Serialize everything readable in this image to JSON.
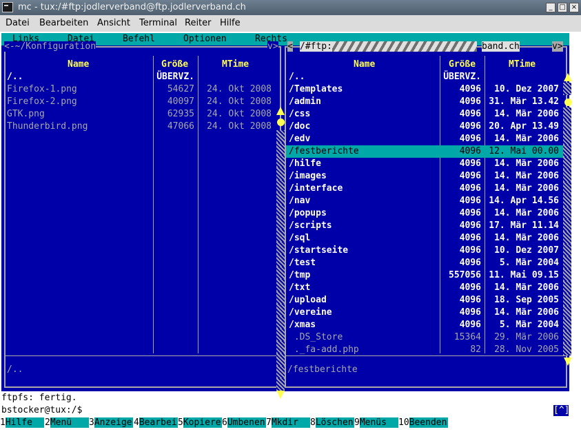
{
  "window": {
    "title": "mc - tux:/#ftp:jodlerverband@ftp.jodlerverband.ch"
  },
  "app_menu": [
    "Datei",
    "Bearbeiten",
    "Ansicht",
    "Terminal",
    "Reiter",
    "Hilfe"
  ],
  "mc_menu": [
    "Links",
    "Datei",
    "Befehl",
    "Optionen",
    "Rechts"
  ],
  "left_panel": {
    "title": "<-~/Konfiguration",
    "title_right": "v>",
    "headers": {
      "name": "Name",
      "size": "Größe",
      "mtime": "MTime"
    },
    "rows": [
      {
        "name": "/..",
        "size": "ÜBERVZ.",
        "mtime": "",
        "style": "bold"
      },
      {
        "name": "Firefox-1.png",
        "size": "54627",
        "mtime": "24. Okt 2008",
        "style": "normal"
      },
      {
        "name": "Firefox-2.png",
        "size": "40097",
        "mtime": "24. Okt 2008",
        "style": "normal"
      },
      {
        "name": "GTK.png",
        "size": "62935",
        "mtime": "24. Okt 2008",
        "style": "normal"
      },
      {
        "name": "Thunderbird.png",
        "size": "47066",
        "mtime": "24. Okt 2008",
        "style": "normal"
      }
    ],
    "current": "/.."
  },
  "right_panel": {
    "title_left": "<",
    "title_path_start": "/#ftp:",
    "title_path_end": "band.ch",
    "title_right": "v>",
    "headers": {
      "name": "Name",
      "size": "Größe",
      "mtime": "MTime"
    },
    "rows": [
      {
        "name": "/..",
        "size": "ÜBERVZ.",
        "mtime": "",
        "style": "bold"
      },
      {
        "name": "/Templates",
        "size": "4096",
        "mtime": "10. Dez 2007",
        "style": "bold"
      },
      {
        "name": "/admin",
        "size": "4096",
        "mtime": "31. Mär 13.42",
        "style": "bold"
      },
      {
        "name": "/css",
        "size": "4096",
        "mtime": "14. Mär 2006",
        "style": "bold"
      },
      {
        "name": "/doc",
        "size": "4096",
        "mtime": "20. Apr 13.49",
        "style": "bold"
      },
      {
        "name": "/edv",
        "size": "4096",
        "mtime": "14. Mär 2006",
        "style": "bold"
      },
      {
        "name": "/festberichte",
        "size": "4096",
        "mtime": "12. Mai 00.00",
        "style": "selected"
      },
      {
        "name": "/hilfe",
        "size": "4096",
        "mtime": "14. Mär 2006",
        "style": "bold"
      },
      {
        "name": "/images",
        "size": "4096",
        "mtime": "14. Mär 2006",
        "style": "bold"
      },
      {
        "name": "/interface",
        "size": "4096",
        "mtime": "14. Mär 2006",
        "style": "bold"
      },
      {
        "name": "/nav",
        "size": "4096",
        "mtime": "14. Apr 14.56",
        "style": "bold"
      },
      {
        "name": "/popups",
        "size": "4096",
        "mtime": "14. Mär 2006",
        "style": "bold"
      },
      {
        "name": "/scripts",
        "size": "4096",
        "mtime": "17. Mär 11.14",
        "style": "bold"
      },
      {
        "name": "/sql",
        "size": "4096",
        "mtime": "14. Mär 2006",
        "style": "bold"
      },
      {
        "name": "/startseite",
        "size": "4096",
        "mtime": "10. Dez 2007",
        "style": "bold"
      },
      {
        "name": "/test",
        "size": "4096",
        "mtime": "5. Mär 2004",
        "style": "bold"
      },
      {
        "name": "/tmp",
        "size": "557056",
        "mtime": "11. Mai 09.15",
        "style": "bold"
      },
      {
        "name": "/txt",
        "size": "4096",
        "mtime": "14. Mär 2006",
        "style": "bold"
      },
      {
        "name": "/upload",
        "size": "4096",
        "mtime": "18. Sep 2005",
        "style": "bold"
      },
      {
        "name": "/vereine",
        "size": "4096",
        "mtime": "14. Mär 2006",
        "style": "bold"
      },
      {
        "name": "/xmas",
        "size": "4096",
        "mtime": "5. Mär 2004",
        "style": "bold"
      },
      {
        "name": " .DS_Store",
        "size": "15364",
        "mtime": "29. Mär 2006",
        "style": "normal"
      },
      {
        "name": " ._fa-add.php",
        "size": "82",
        "mtime": "28. Nov 2005",
        "style": "normal"
      }
    ],
    "current": "/festberichte"
  },
  "status_line": "ftpfs: fertig.",
  "prompt": "bstocker@tux:/$",
  "history_button": "[^]",
  "function_keys": [
    {
      "num": "1",
      "label": "Hilfe"
    },
    {
      "num": "2",
      "label": "Menü"
    },
    {
      "num": "3",
      "label": "Anzeige"
    },
    {
      "num": "4",
      "label": "Bearbei"
    },
    {
      "num": "5",
      "label": "Kopiere"
    },
    {
      "num": "6",
      "label": "Umbenen"
    },
    {
      "num": "7",
      "label": "Mkdir"
    },
    {
      "num": "8",
      "label": "Löschen"
    },
    {
      "num": "9",
      "label": "Menüs"
    },
    {
      "num": "10",
      "label": "Beenden"
    }
  ],
  "colors": {
    "panel_bg": "#0000a8",
    "cyan": "#00a8a8",
    "header_yellow": "#ffff54",
    "frame_gray": "#a8a8a8"
  }
}
